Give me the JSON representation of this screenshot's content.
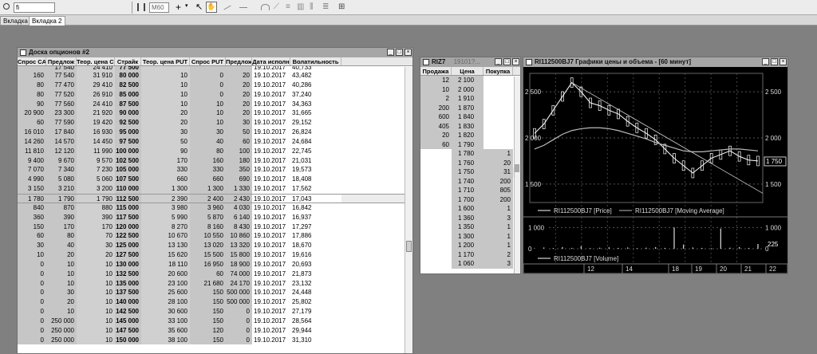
{
  "toolbar": {
    "search_value": "fi",
    "zoom_value": "M60",
    "icons": [
      "bar-chart-icon",
      "crosshair-icon",
      "pointer-icon",
      "hand-icon",
      "line-icon",
      "draw-icon",
      "fib-icon",
      "grid-icon"
    ]
  },
  "tabs": [
    {
      "label": "Вкладка 1"
    },
    {
      "label": "Вкладка 2"
    }
  ],
  "options": {
    "title": "Доска опционов #2",
    "columns": [
      "Спрос CALL",
      "Предлож",
      "Теор. цена CALL",
      "Страйк",
      "Теор. цена PUT",
      "Спрос PUT",
      "Предлож",
      "Дата исполн",
      "Волатильность"
    ],
    "top_row": [
      "",
      "17 540",
      "24 410",
      "77 500",
      "",
      "",
      "",
      "19.10.2017",
      "40,733"
    ],
    "rows": [
      [
        "160",
        "77 540",
        "31 910",
        "80 000",
        "10",
        "0",
        "20",
        "19.10.2017",
        "43,482"
      ],
      [
        "80",
        "77 470",
        "29 410",
        "82 500",
        "10",
        "0",
        "20",
        "19.10.2017",
        "40,286"
      ],
      [
        "80",
        "77 520",
        "26 910",
        "85 000",
        "10",
        "0",
        "20",
        "19.10.2017",
        "37,240"
      ],
      [
        "90",
        "77 560",
        "24 410",
        "87 500",
        "10",
        "10",
        "20",
        "19.10.2017",
        "34,363"
      ],
      [
        "20 900",
        "23 300",
        "21 920",
        "90 000",
        "20",
        "10",
        "20",
        "19.10.2017",
        "31,665"
      ],
      [
        "60",
        "77 590",
        "19 420",
        "92 500",
        "20",
        "10",
        "30",
        "19.10.2017",
        "29,152"
      ],
      [
        "16 010",
        "17 840",
        "16 930",
        "95 000",
        "30",
        "30",
        "50",
        "19.10.2017",
        "26,824"
      ],
      [
        "14 260",
        "14 570",
        "14 450",
        "97 500",
        "50",
        "40",
        "60",
        "19.10.2017",
        "24,684"
      ],
      [
        "11 810",
        "12 120",
        "11 990",
        "100 000",
        "90",
        "80",
        "100",
        "19.10.2017",
        "22,745"
      ],
      [
        "9 400",
        "9 670",
        "9 570",
        "102 500",
        "170",
        "160",
        "180",
        "19.10.2017",
        "21,031"
      ],
      [
        "7 070",
        "7 340",
        "7 230",
        "105 000",
        "330",
        "330",
        "350",
        "19.10.2017",
        "19,573"
      ],
      [
        "4 990",
        "5 080",
        "5 060",
        "107 500",
        "660",
        "660",
        "690",
        "19.10.2017",
        "18,408"
      ],
      [
        "3 150",
        "3 210",
        "3 200",
        "110 000",
        "1 300",
        "1 300",
        "1 330",
        "19.10.2017",
        "17,562"
      ],
      [
        "1 780",
        "1 790",
        "1 790",
        "112 500",
        "2 390",
        "2 400",
        "2 430",
        "19.10.2017",
        "17,043"
      ],
      [
        "840",
        "870",
        "880",
        "115 000",
        "3 980",
        "3 960",
        "4 030",
        "19.10.2017",
        "16,842"
      ],
      [
        "360",
        "390",
        "390",
        "117 500",
        "5 990",
        "5 870",
        "6 140",
        "19.10.2017",
        "16,937"
      ],
      [
        "150",
        "170",
        "170",
        "120 000",
        "8 270",
        "8 160",
        "8 430",
        "19.10.2017",
        "17,297"
      ],
      [
        "60",
        "80",
        "70",
        "122 500",
        "10 670",
        "10 550",
        "10 860",
        "19.10.2017",
        "17,886"
      ],
      [
        "30",
        "40",
        "30",
        "125 000",
        "13 130",
        "13 020",
        "13 320",
        "19.10.2017",
        "18,670"
      ],
      [
        "10",
        "20",
        "20",
        "127 500",
        "15 620",
        "15 500",
        "15 800",
        "19.10.2017",
        "19,616"
      ],
      [
        "0",
        "10",
        "10",
        "130 000",
        "18 110",
        "16 950",
        "18 900",
        "19.10.2017",
        "20,693"
      ],
      [
        "0",
        "10",
        "10",
        "132 500",
        "20 600",
        "60",
        "74 000",
        "19.10.2017",
        "21,873"
      ],
      [
        "0",
        "10",
        "10",
        "135 000",
        "23 100",
        "21 680",
        "24 170",
        "19.10.2017",
        "23,132"
      ],
      [
        "0",
        "30",
        "10",
        "137 500",
        "25 600",
        "150",
        "500 000",
        "19.10.2017",
        "24,448"
      ],
      [
        "0",
        "20",
        "10",
        "140 000",
        "28 100",
        "150",
        "500 000",
        "19.10.2017",
        "25,802"
      ],
      [
        "0",
        "10",
        "10",
        "142 500",
        "30 600",
        "150",
        "0",
        "19.10.2017",
        "27,179"
      ],
      [
        "0",
        "250 000",
        "10",
        "145 000",
        "33 100",
        "150",
        "0",
        "19.10.2017",
        "28,564"
      ],
      [
        "0",
        "250 000",
        "10",
        "147 500",
        "35 600",
        "120",
        "0",
        "19.10.2017",
        "29,944"
      ],
      [
        "0",
        "250 000",
        "10",
        "150 000",
        "38 100",
        "150",
        "0",
        "19.10.2017",
        "31,310"
      ]
    ]
  },
  "ob": {
    "title": "RIZ7",
    "title_extra": "19101?...",
    "columns": [
      "Продажа",
      "Цена",
      "Покупка"
    ],
    "rows": [
      [
        "12",
        "2 100",
        ""
      ],
      [
        "10",
        "2 000",
        ""
      ],
      [
        "2",
        "1 910",
        ""
      ],
      [
        "200",
        "1 870",
        ""
      ],
      [
        "600",
        "1 840",
        ""
      ],
      [
        "405",
        "1 830",
        ""
      ],
      [
        "20",
        "1 820",
        ""
      ],
      [
        "60",
        "1 790",
        ""
      ],
      [
        "",
        "1 780",
        "1"
      ],
      [
        "",
        "1 760",
        "20"
      ],
      [
        "",
        "1 750",
        "31"
      ],
      [
        "",
        "1 740",
        "200"
      ],
      [
        "",
        "1 710",
        "805"
      ],
      [
        "",
        "1 700",
        "200"
      ],
      [
        "",
        "1 600",
        "1"
      ],
      [
        "",
        "1 360",
        "3"
      ],
      [
        "",
        "1 350",
        "1"
      ],
      [
        "",
        "1 300",
        "1"
      ],
      [
        "",
        "1 200",
        "1"
      ],
      [
        "",
        "1 170",
        "2"
      ],
      [
        "",
        "1 060",
        "3"
      ]
    ]
  },
  "chart": {
    "title": "RI112500BJ7 Графики цены и объема - [60 минут]",
    "legend_price": "RI112500BJ7 [Price]",
    "legend_ma": "RI112500BJ7 [Moving Average]",
    "legend_volume": "RI112500BJ7 [Volume]",
    "y_ticks": [
      "2 500",
      "2 000",
      "1 500"
    ],
    "vol_ticks": [
      "1 000",
      "0"
    ],
    "last_price": "1 750",
    "last_volume": "225",
    "x_ticks": [
      "12",
      "14",
      "18",
      "19",
      "20",
      "21",
      "22"
    ]
  },
  "chart_data": {
    "type": "line",
    "series": [
      {
        "name": "RI112500BJ7 [Price]",
        "values": [
          2050,
          2150,
          2300,
          2450,
          2600,
          2500,
          2380,
          2350,
          2300,
          2260,
          2180,
          2110,
          2050,
          1980,
          1880,
          1780,
          1700,
          1620,
          1700,
          1780,
          1820,
          1860,
          1800,
          1760,
          1750
        ]
      },
      {
        "name": "RI112500BJ7 [Moving Average]",
        "values": [
          1880,
          1920,
          1980,
          2040,
          2080,
          2100,
          2110,
          2110,
          2100,
          2080,
          2050,
          2020,
          1990,
          1950,
          1920,
          1890,
          1860,
          1850,
          1850,
          1860,
          1870,
          1880,
          1880,
          1870,
          1860
        ]
      }
    ],
    "ylim": [
      1300,
      2700
    ],
    "volume": {
      "name": "RI112500BJ7 [Volume]",
      "values": [
        20,
        60,
        30,
        80,
        40,
        120,
        30,
        50,
        70,
        40,
        60,
        30,
        50,
        80,
        40,
        1000,
        200,
        60,
        40,
        30,
        950,
        50,
        80,
        40,
        225
      ],
      "ylim": [
        0,
        1200
      ]
    }
  }
}
